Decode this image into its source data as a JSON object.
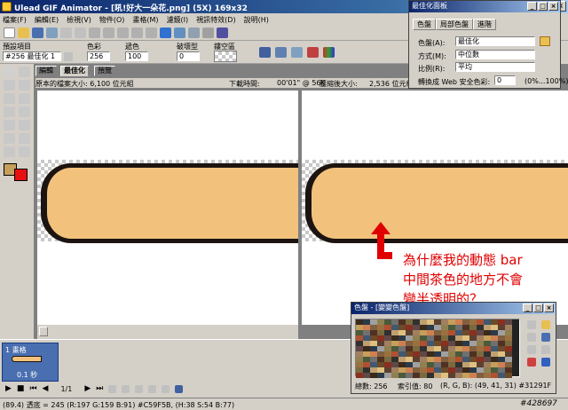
{
  "window": {
    "title": "Ulead GIF Animator - [吼!好大一朵花.png] (5X) 169x32",
    "controls": [
      "_",
      "□",
      "×"
    ]
  },
  "menu": [
    "檔案(F)",
    "編輯(E)",
    "檢視(V)",
    "物件(O)",
    "畫格(M)",
    "濾鏡(I)",
    "視訊特效(D)",
    "說明(H)"
  ],
  "options": {
    "preset_label": "預設項目",
    "preset_value": "#256 最佳化 1",
    "color_label": "色彩",
    "color_value": "256",
    "dither_label": "遞色",
    "dither_value": "100",
    "lossy_label": "破壞型",
    "lossy_value": "0",
    "transparency_label": "鏤空區"
  },
  "tabs": {
    "edit": "編輯",
    "optimize": "最佳化",
    "preview": "預覽"
  },
  "info": {
    "original_size": "原本的檔案大小:   6,100 位元組",
    "download_time": "下載時間:",
    "download_speed": "00'01\" @ 56K",
    "compressed": "壓縮後大小:",
    "compressed_value": "2,536 位元組"
  },
  "optimize_panel": {
    "title": "最佳化面板",
    "tabs": [
      "色盤",
      "局部色盤",
      "進階"
    ],
    "palette_label": "色盤(A):",
    "palette_value": "最佳化",
    "method_label": "方式(M):",
    "method_value": "中位數",
    "ratio_label": "比例(R):",
    "ratio_value": "平均",
    "web_label": "轉換成 Web 安全色彩:",
    "web_value": "0",
    "web_range": "(0%...100%)"
  },
  "palette_window": {
    "title": "色盤 - [變變色盤]",
    "total_label": "總數: 256",
    "index_label": "索引值: 80",
    "rgb_label": "(R, G, B): (49, 41, 31) #31291F"
  },
  "annotation": {
    "line1": "為什麼我的動態 bar",
    "line2": "中間茶色的地方不會",
    "line3": "變半透明的？"
  },
  "frames": {
    "frame_label": "1 畫格",
    "frame_time": "0.1 秒",
    "page": "1/1"
  },
  "statusbar": {
    "text": "(89.4) 透底 = 245 (R:197 G:159 B:91) #C59F5B, (H:38 S:54 B:77)"
  },
  "watermark": "#428697",
  "colors": {
    "bar_fill": "#f2c27d",
    "bar_border": "#1c1410",
    "annotation": "#e00000",
    "title_blue": "#0a246a"
  }
}
